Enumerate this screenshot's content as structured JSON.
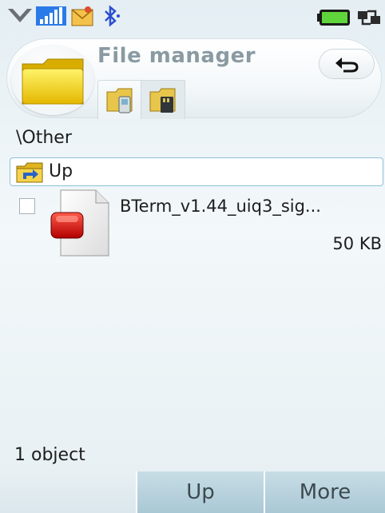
{
  "header": {
    "title": "File manager"
  },
  "path": "\\Other",
  "up_row": {
    "label": "Up"
  },
  "files": [
    {
      "name": "BTerm_v1.44_uiq3_sig...",
      "size": "50 KB"
    }
  ],
  "status": {
    "object_count": "1 object"
  },
  "softkeys": {
    "up": "Up",
    "more": "More"
  },
  "icons": {
    "status": [
      "signal-icon",
      "network-bars-icon",
      "message-icon",
      "bluetooth-icon",
      "battery-icon",
      "connection-icon"
    ],
    "header": [
      "folder-icon",
      "back-icon"
    ],
    "tabs": [
      "phone-memory-icon",
      "memory-card-icon"
    ],
    "file": "sis-file-icon"
  },
  "colors": {
    "accent_border": "#8fc0d8",
    "softkey_bg": "#b6d2dd",
    "title": "#8a9aa2"
  }
}
